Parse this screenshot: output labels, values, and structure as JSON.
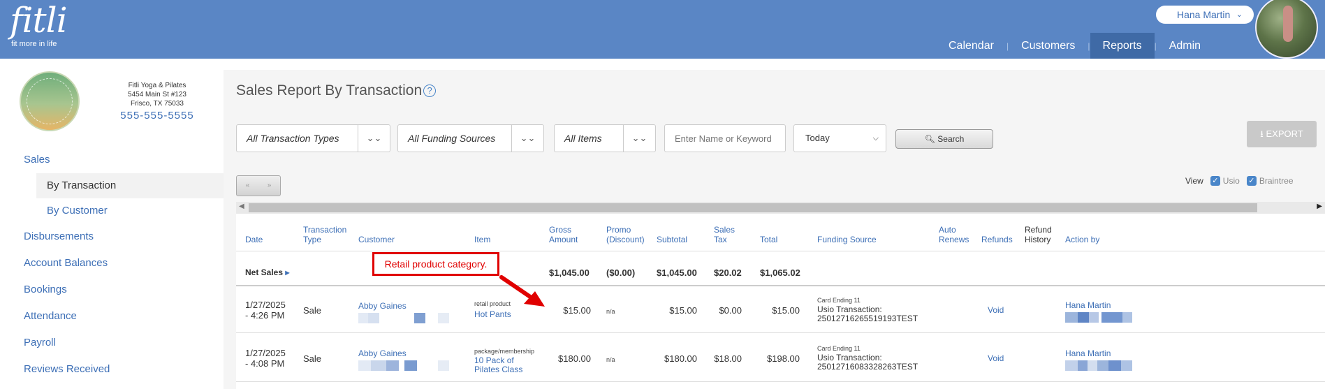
{
  "header": {
    "logo_text": "fitli",
    "logo_tagline": "fit more in life",
    "user_name": "Hana Martin",
    "nav": [
      {
        "label": "Calendar"
      },
      {
        "label": "Customers"
      },
      {
        "label": "Reports",
        "active": true
      },
      {
        "label": "Admin"
      }
    ]
  },
  "studio": {
    "name": "Fitli Yoga & Pilates",
    "address1": "5454 Main St #123",
    "address2": "Frisco, TX 75033",
    "phone": "555-555-5555"
  },
  "sidebar": {
    "items": [
      {
        "label": "Sales"
      },
      {
        "label": "By Transaction",
        "sub": true,
        "active": true
      },
      {
        "label": "By Customer",
        "sub": true
      },
      {
        "label": "Disbursements"
      },
      {
        "label": "Account Balances"
      },
      {
        "label": "Bookings"
      },
      {
        "label": "Attendance"
      },
      {
        "label": "Payroll"
      },
      {
        "label": "Reviews Received"
      }
    ]
  },
  "page": {
    "title": "Sales Report By Transaction",
    "filters": {
      "transaction_types": "All Transaction Types",
      "funding_sources": "All Funding Sources",
      "items": "All Items",
      "keyword_placeholder": "Enter Name or Keyword",
      "date_range": "Today",
      "search_label": "Search",
      "export_label": "EXPORT"
    },
    "pager": {
      "prev": "«",
      "next": "»"
    },
    "view": {
      "label": "View",
      "options": [
        {
          "label": "Usio",
          "checked": true
        },
        {
          "label": "Braintree",
          "checked": true
        }
      ]
    }
  },
  "table": {
    "columns": [
      {
        "label": "Date",
        "sortable": true
      },
      {
        "label": "Transaction Type",
        "sortable": true
      },
      {
        "label": "Customer",
        "sortable": true
      },
      {
        "label": "Item",
        "sortable": true
      },
      {
        "label": "Gross Amount",
        "sortable": true
      },
      {
        "label": "Promo (Discount)",
        "sortable": true
      },
      {
        "label": "Subtotal",
        "sortable": true
      },
      {
        "label": "Sales Tax",
        "sortable": true
      },
      {
        "label": "Total",
        "sortable": true
      },
      {
        "label": "Funding Source",
        "sortable": true
      },
      {
        "label": "Auto Renews",
        "sortable": true
      },
      {
        "label": "Refunds",
        "sortable": true
      },
      {
        "label": "Refund History",
        "sortable": false
      },
      {
        "label": "Action by",
        "sortable": true
      }
    ],
    "net_sales": {
      "label": "Net Sales",
      "gross": "$1,045.00",
      "promo": "($0.00)",
      "subtotal": "$1,045.00",
      "tax": "$20.02",
      "total": "$1,065.02"
    },
    "rows": [
      {
        "date": "1/27/2025",
        "time": "- 4:26 PM",
        "type": "Sale",
        "customer": "Abby Gaines",
        "item_category": "retail product",
        "item_name": "Hot Pants",
        "gross": "$15.00",
        "promo": "n/a",
        "subtotal": "$15.00",
        "tax": "$0.00",
        "total": "$15.00",
        "card": "Card Ending 11",
        "transaction": "Usio Transaction:",
        "transaction_id": "25012716265519193TEST",
        "refund_action": "Void",
        "action_by": "Hana Martin"
      },
      {
        "date": "1/27/2025",
        "time": "- 4:08 PM",
        "type": "Sale",
        "customer": "Abby Gaines",
        "item_category": "package/membership",
        "item_name": "10 Pack of",
        "item_name2": "Pilates Class",
        "gross": "$180.00",
        "promo": "n/a",
        "subtotal": "$180.00",
        "tax": "$18.00",
        "total": "$198.00",
        "card": "Card Ending 11",
        "transaction": "Usio Transaction:",
        "transaction_id": "25012716083328263TEST",
        "refund_action": "Void",
        "action_by": "Hana Martin"
      }
    ]
  },
  "annotation": {
    "text": "Retail product category."
  },
  "colors": {
    "header_bg": "#5a86c5",
    "link": "#3d6fb6",
    "annotation": "#e00000"
  }
}
